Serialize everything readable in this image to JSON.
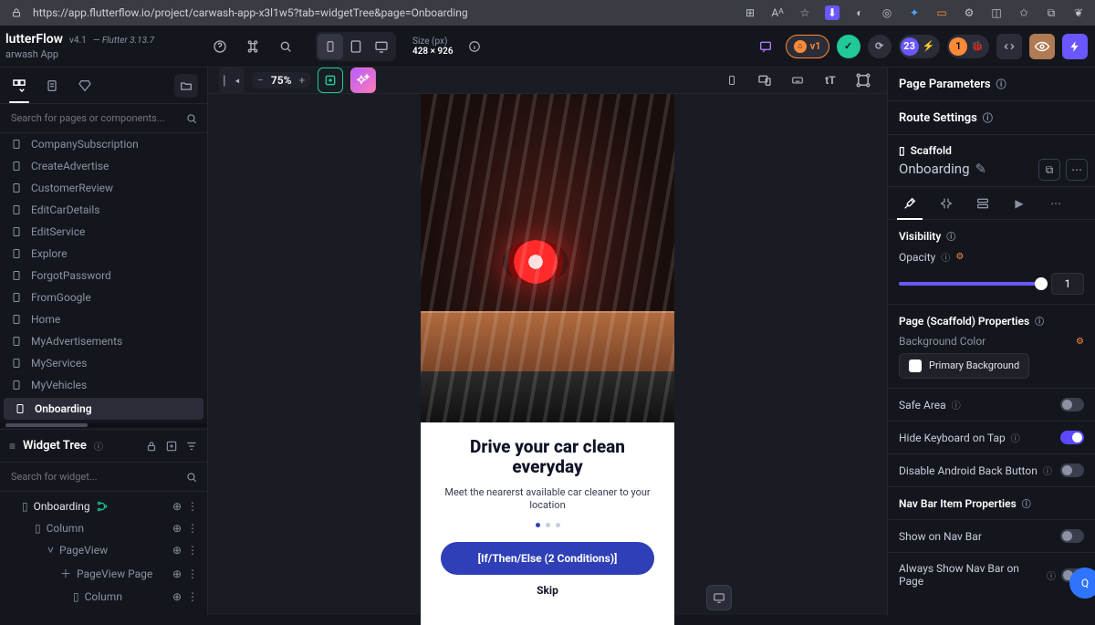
{
  "url": "https://app.flutterflow.io/project/carwash-app-x3l1w5?tab=widgetTree&page=Onboarding",
  "brand": {
    "name": "lutterFlow",
    "version": "v4.1",
    "flutter": "— Flutter 3.13.7",
    "project": "arwash App"
  },
  "deviceSize": {
    "label": "Size (px)",
    "value": "428 × 926"
  },
  "topBadges": {
    "v": "v1",
    "issues": "23",
    "warnings": "1"
  },
  "leftSearch": {
    "placeholder": "Search for pages or components..."
  },
  "pages": [
    {
      "label": "CompanySubscription"
    },
    {
      "label": "CreateAdvertise"
    },
    {
      "label": "CustomerReview"
    },
    {
      "label": "EditCarDetails"
    },
    {
      "label": "EditService"
    },
    {
      "label": "Explore"
    },
    {
      "label": "ForgotPassword"
    },
    {
      "label": "FromGoogle"
    },
    {
      "label": "Home"
    },
    {
      "label": "MyAdvertisements"
    },
    {
      "label": "MyServices"
    },
    {
      "label": "MyVehicles"
    },
    {
      "label": "Onboarding",
      "selected": true
    }
  ],
  "widgetTree": {
    "title": "Widget Tree",
    "searchPlaceholder": "Search for widget...",
    "nodes": [
      {
        "label": "Onboarding",
        "depth": 0,
        "branch": true
      },
      {
        "label": "Column",
        "depth": 1
      },
      {
        "label": "PageView",
        "depth": 2,
        "chev": true
      },
      {
        "label": "PageView Page",
        "depth": 3,
        "plus": true
      },
      {
        "label": "Column",
        "depth": 4
      }
    ]
  },
  "canvas": {
    "zoom": "75%"
  },
  "onboarding": {
    "title1": "Drive your car clean",
    "title2": "everyday",
    "subtitle": "Meet the  nearerst available car cleaner to your location",
    "cta": "[If/Then/Else (2 Conditions)]",
    "skip": "Skip"
  },
  "right": {
    "pageParams": "Page Parameters",
    "routeSettings": "Route Settings",
    "scaffoldIcon": "Scaffold",
    "pageName": "Onboarding",
    "visibility": "Visibility",
    "opacity": "Opacity",
    "opacityVal": "1",
    "propsTitle": "Page (Scaffold) Properties",
    "bgColor": "Background Color",
    "swatch": "Primary Background",
    "safeArea": "Safe Area",
    "hideKeyboard": "Hide Keyboard on Tap",
    "disableBack": "Disable Android Back Button",
    "navTitle": "Nav Bar Item Properties",
    "showNav": "Show on Nav Bar",
    "alwaysNav": "Always Show Nav Bar on Page"
  }
}
